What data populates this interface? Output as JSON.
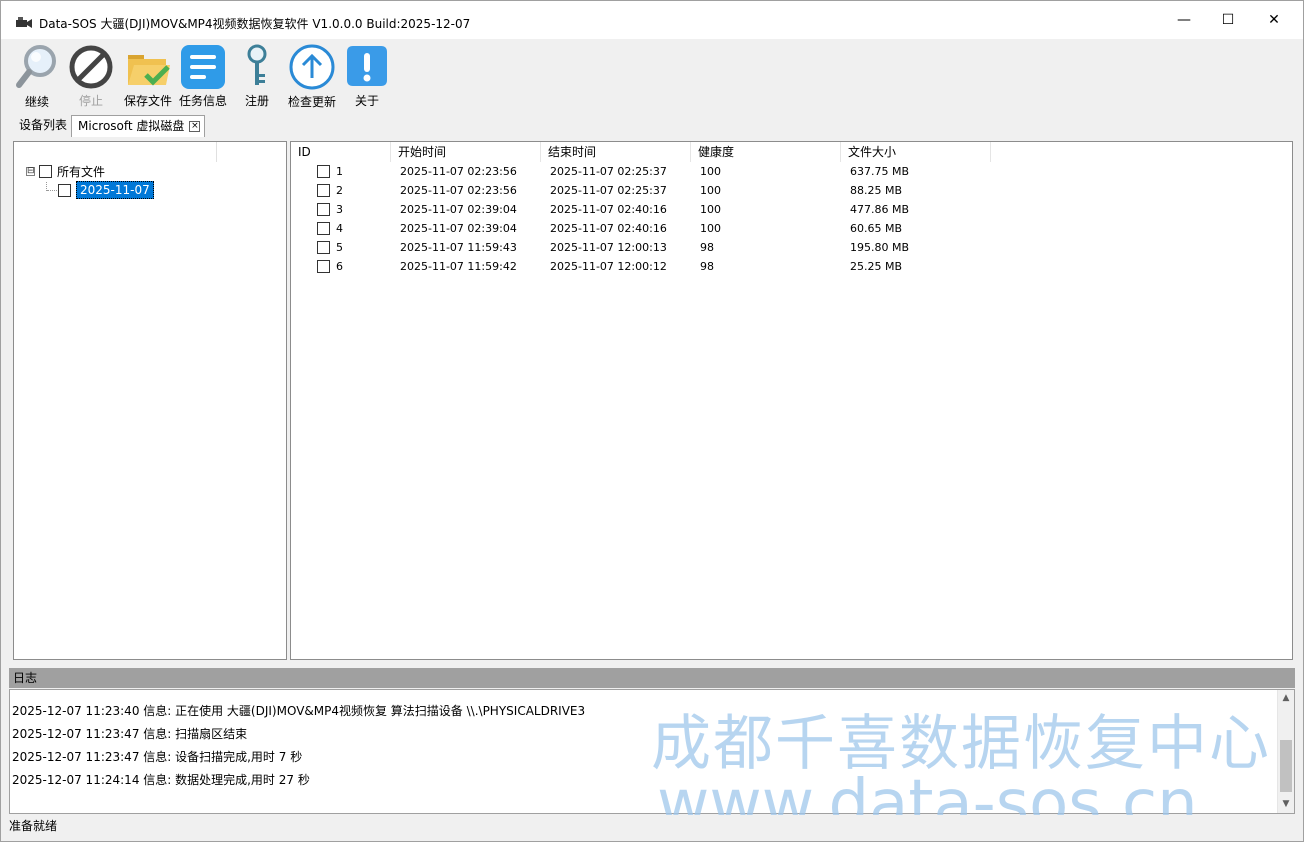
{
  "window": {
    "title": "Data-SOS 大疆(DJI)MOV&MP4视频数据恢复软件 V1.0.0.0  Build:2025-12-07",
    "min_glyph": "—",
    "max_glyph": "☐",
    "close_glyph": "✕"
  },
  "toolbar": {
    "continue_label": "继续",
    "stop_label": "停止",
    "save_label": "保存文件",
    "task_label": "任务信息",
    "register_label": "注册",
    "update_label": "检查更新",
    "about_label": "关于"
  },
  "tabs": {
    "device_list": "设备列表",
    "disk": "Microsoft 虚拟磁盘",
    "close_glyph": "×"
  },
  "tree": {
    "root_label": "所有文件",
    "root_expander": "⊟",
    "child_label": "2025-11-07"
  },
  "list": {
    "headers": {
      "id": "ID",
      "start": "开始时间",
      "end": "结束时间",
      "health": "健康度",
      "size": "文件大小"
    },
    "rows": [
      {
        "id": "1",
        "start": "2025-11-07 02:23:56",
        "end": "2025-11-07 02:25:37",
        "health": "100",
        "size": "637.75 MB"
      },
      {
        "id": "2",
        "start": "2025-11-07 02:23:56",
        "end": "2025-11-07 02:25:37",
        "health": "100",
        "size": "88.25 MB"
      },
      {
        "id": "3",
        "start": "2025-11-07 02:39:04",
        "end": "2025-11-07 02:40:16",
        "health": "100",
        "size": "477.86 MB"
      },
      {
        "id": "4",
        "start": "2025-11-07 02:39:04",
        "end": "2025-11-07 02:40:16",
        "health": "100",
        "size": "60.65 MB"
      },
      {
        "id": "5",
        "start": "2025-11-07 11:59:43",
        "end": "2025-11-07 12:00:13",
        "health": "98",
        "size": "195.80 MB"
      },
      {
        "id": "6",
        "start": "2025-11-07 11:59:42",
        "end": "2025-11-07 12:00:12",
        "health": "98",
        "size": "25.25 MB"
      }
    ]
  },
  "log": {
    "title": "日志",
    "lines": [
      "2025-12-07 11:23:40 信息: 正在使用 大疆(DJI)MOV&MP4视频恢复 算法扫描设备 \\\\.\\PHYSICALDRIVE3",
      "2025-12-07 11:23:47 信息: 扫描扇区结束",
      "2025-12-07 11:23:47 信息: 设备扫描完成,用时 7 秒",
      "2025-12-07 11:24:14 信息: 数据处理完成,用时 27 秒"
    ],
    "scroll_up": "▲",
    "scroll_down": "▼"
  },
  "watermark": {
    "company": "成都千喜数据恢复中心",
    "url": "www.data-sos.cn"
  },
  "status": {
    "text": "准备就绪"
  },
  "colors": {
    "selection": "#0078d7",
    "icon_blue": "#3a9be8",
    "watermark": "#9fc7ec"
  }
}
